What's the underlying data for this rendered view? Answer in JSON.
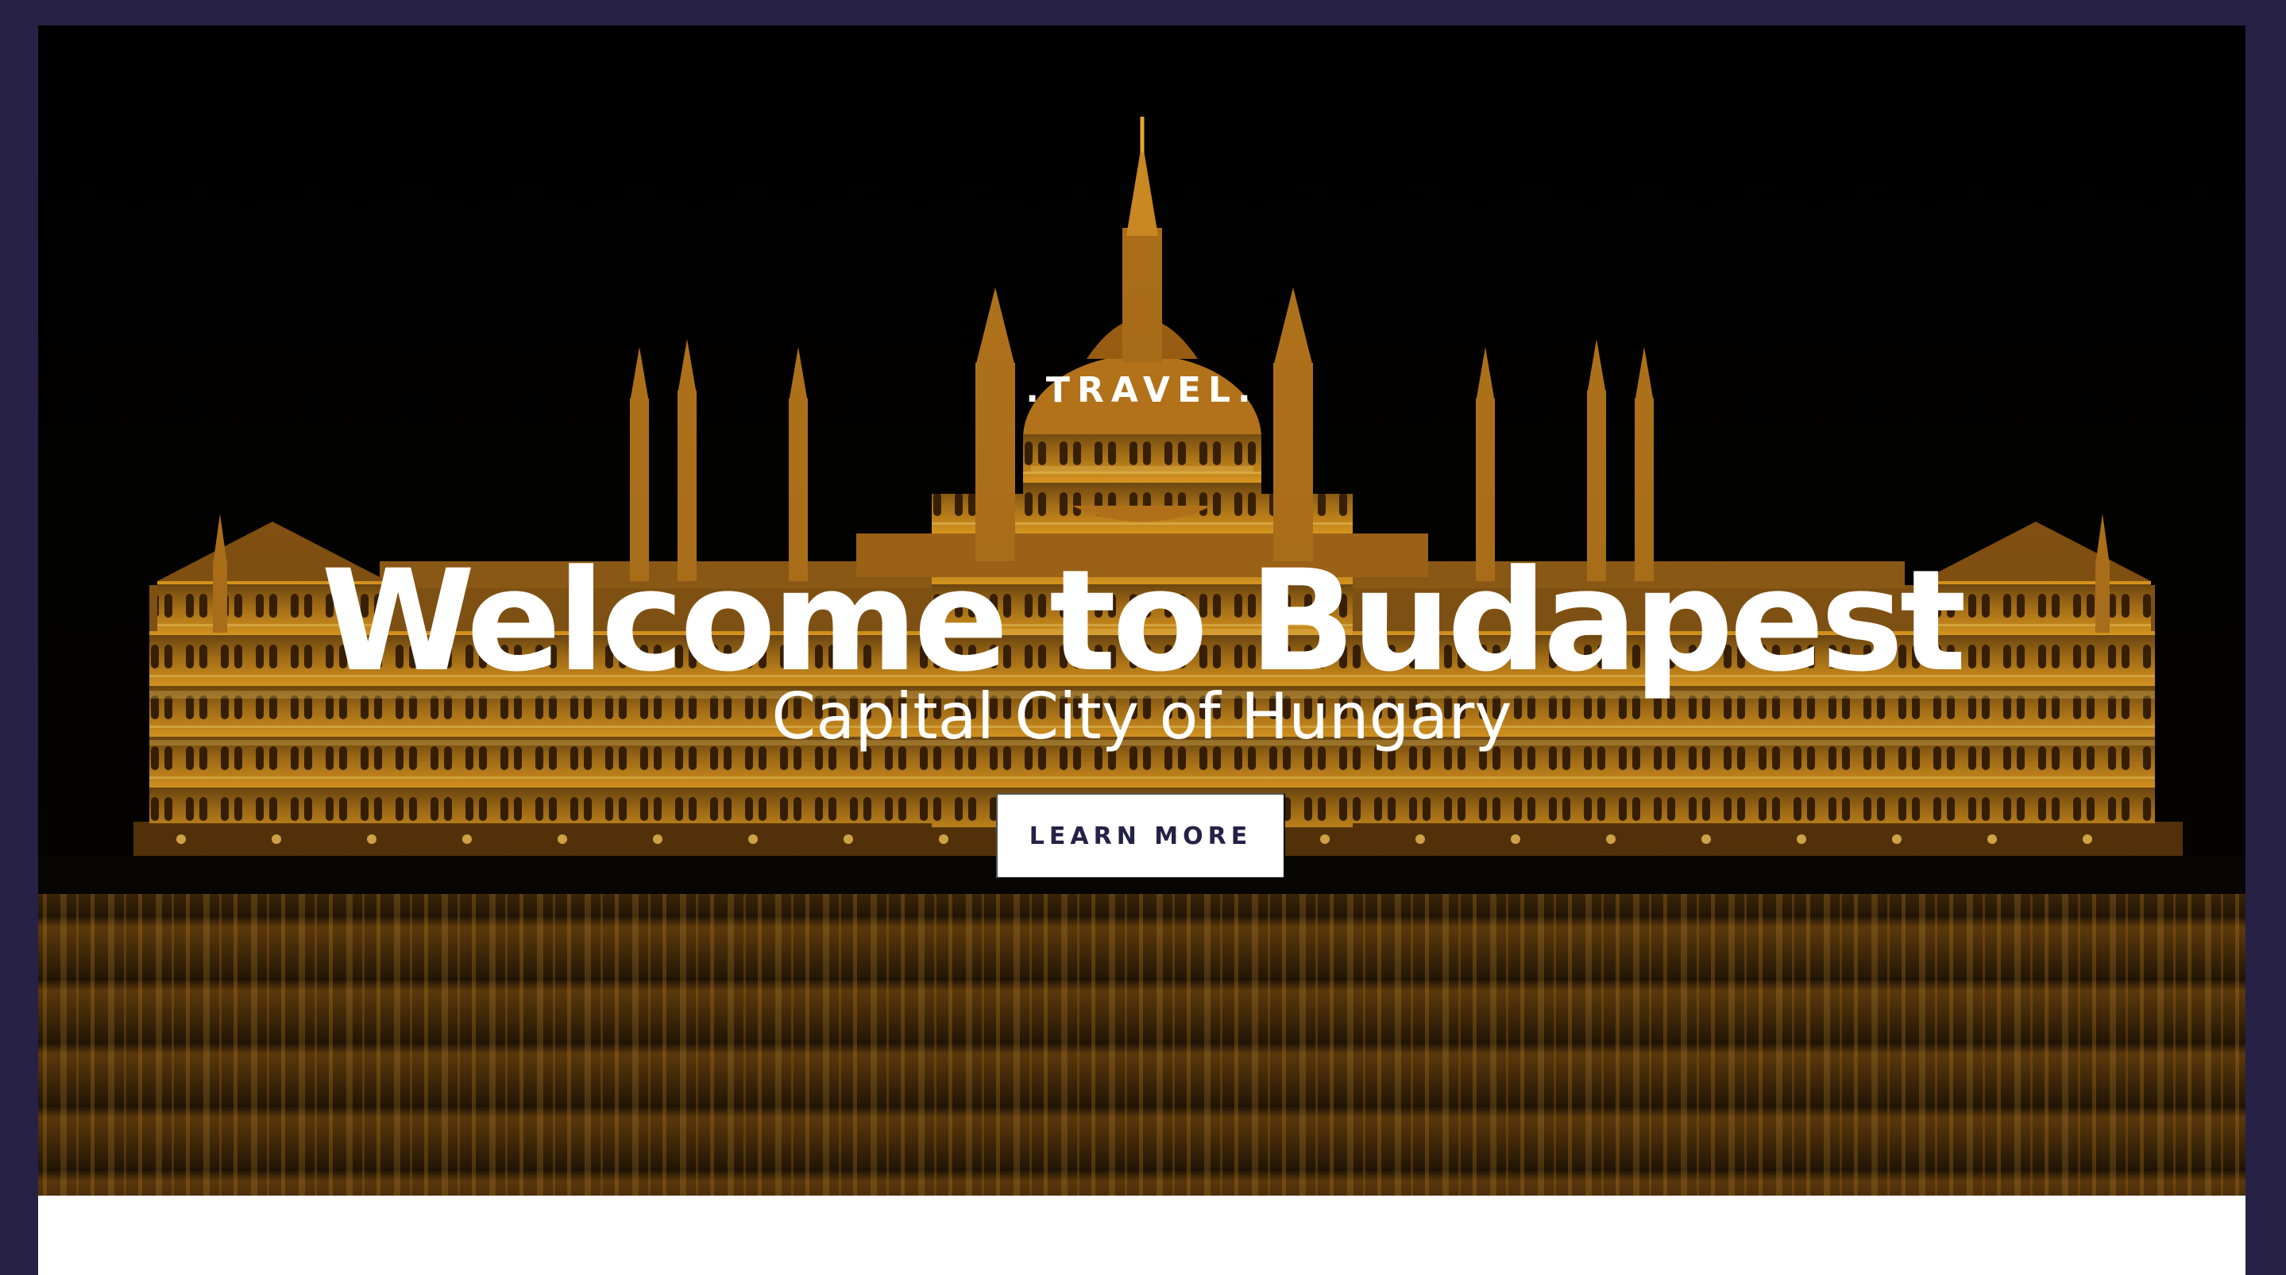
{
  "hero": {
    "eyebrow": ".TRAVEL.",
    "title": "Welcome to Budapest",
    "subtitle": "Capital City of Hungary",
    "cta_label": "LEARN MORE",
    "background_image": "parliament-building-night",
    "colors": {
      "frame": "#262145",
      "cta_text": "#262145",
      "text": "#ffffff",
      "light": "#f2b233"
    }
  }
}
